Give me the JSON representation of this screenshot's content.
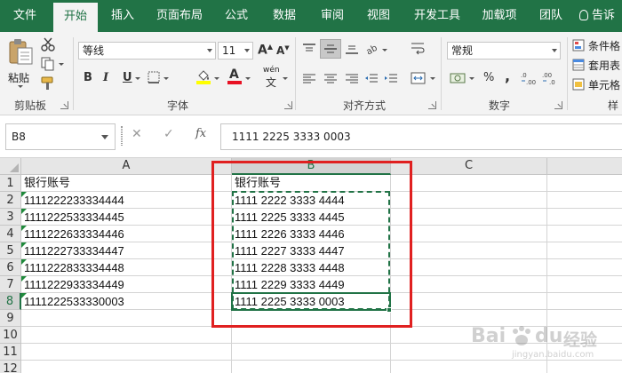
{
  "tabs": [
    {
      "label": "文件",
      "active": false
    },
    {
      "label": "开始",
      "active": true
    },
    {
      "label": "插入",
      "active": false
    },
    {
      "label": "页面布局",
      "active": false
    },
    {
      "label": "公式",
      "active": false
    },
    {
      "label": "数据",
      "active": false
    },
    {
      "label": "审阅",
      "active": false
    },
    {
      "label": "视图",
      "active": false
    },
    {
      "label": "开发工具",
      "active": false
    },
    {
      "label": "加载项",
      "active": false
    },
    {
      "label": "团队",
      "active": false
    }
  ],
  "tell_me": "告诉",
  "ribbon": {
    "clipboard": {
      "label": "剪贴板",
      "paste": "粘贴"
    },
    "font": {
      "label": "字体",
      "font_name": "等线",
      "font_size": "11",
      "bold": "B",
      "italic": "I",
      "underline": "U",
      "phonetic": "wén"
    },
    "alignment": {
      "label": "对齐方式"
    },
    "number": {
      "label": "数字",
      "format": "常规",
      "percent": "%",
      "comma": ","
    },
    "styles": {
      "conditional": "条件格",
      "table": "套用表",
      "cell": "单元格",
      "label": "样"
    }
  },
  "formula_bar": {
    "name_box": "B8",
    "fx": "fx",
    "content": "1111 2225 3333 0003"
  },
  "sheet": {
    "columns": [
      {
        "label": "A"
      },
      {
        "label": "B",
        "selected": true
      },
      {
        "label": "C"
      }
    ],
    "rows": [
      "1",
      "2",
      "3",
      "4",
      "5",
      "6",
      "7",
      "8",
      "9",
      "10",
      "11",
      "12"
    ],
    "colA": [
      "银行账号",
      "1111222233334444",
      "1111222533334445",
      "1111222633334446",
      "1111222733334447",
      "1111222833334448",
      "1111222933334449",
      "1111222533330003"
    ],
    "colB": [
      "银行账号",
      "1111 2222 3333 4444",
      "1111 2225 3333 4445",
      "1111 2226 3333 4446",
      "1111 2227 3333 4447",
      "1111 2228 3333 4448",
      "1111 2229 3333 4449",
      "1111 2225 3333 0003"
    ]
  },
  "watermark": {
    "brand": "Bai",
    "brand2": "du",
    "cn": "经验",
    "sub": "jingyan.baidu.com"
  },
  "colors": {
    "excel_green": "#217346",
    "highlight_red": "#e02020",
    "error_triangle": "#1f8a3b"
  }
}
